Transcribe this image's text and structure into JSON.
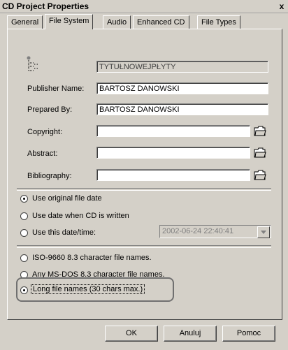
{
  "window": {
    "title": "CD Project Properties",
    "close_glyph": "x"
  },
  "tabs": [
    {
      "label": "General"
    },
    {
      "label": "File System"
    },
    {
      "label": "Audio"
    },
    {
      "label": "Enhanced CD"
    },
    {
      "label": "File Types"
    }
  ],
  "volume": {
    "value": "TYTUŁNOWEJPŁYTY"
  },
  "fields": {
    "publisher": {
      "label": "Publisher Name:",
      "value": "BARTOSZ DANOWSKI"
    },
    "prepared": {
      "label": "Prepared By:",
      "value": "BARTOSZ DANOWSKI"
    },
    "copyright": {
      "label": "Copyright:",
      "value": ""
    },
    "abstract": {
      "label": "Abstract:",
      "value": ""
    },
    "bibliography": {
      "label": "Bibliography:",
      "value": ""
    }
  },
  "date_options": [
    {
      "label": "Use original file date",
      "checked": true
    },
    {
      "label": "Use date when CD is written",
      "checked": false
    },
    {
      "label": "Use this date/time:",
      "checked": false
    }
  ],
  "date_value": "2002-06-24   22:40:41",
  "name_options": [
    {
      "label": "ISO-9660 8.3 character file names.",
      "checked": false
    },
    {
      "label": "Any MS-DOS 8.3 character file names.",
      "checked": false
    },
    {
      "label": "Long file names (30 chars max.)",
      "checked": true
    }
  ],
  "buttons": {
    "ok": "OK",
    "cancel": "Anuluj",
    "help": "Pomoc"
  },
  "icons": {
    "tree": "tree-structure-icon",
    "browse": "open-folder-icon",
    "dropdown": "chevron-down-icon"
  }
}
